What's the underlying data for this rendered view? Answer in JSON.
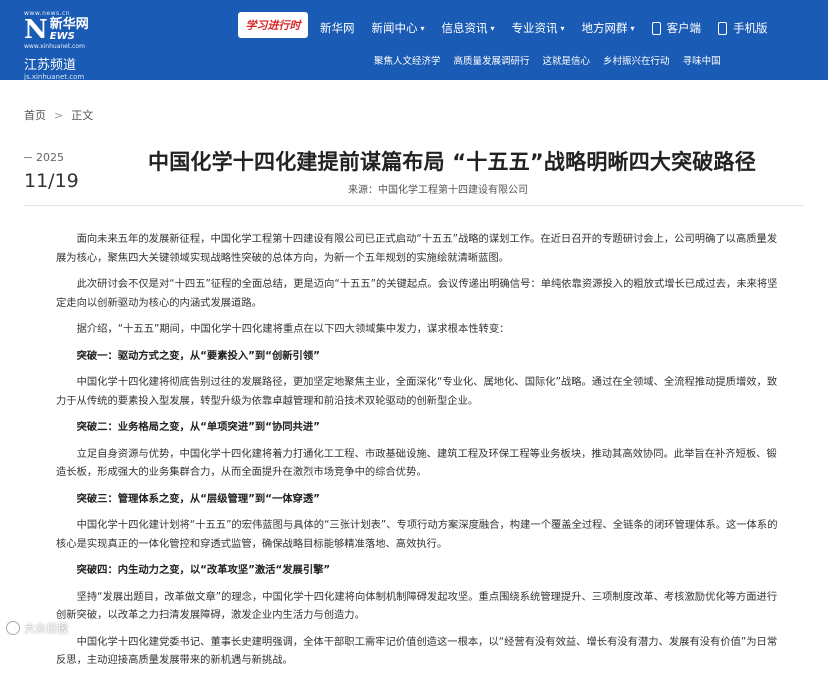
{
  "header": {
    "logo_url": "www.news.cn",
    "logo_n": "N",
    "logo_cn": "新华网",
    "logo_news": "EWS",
    "logo_url2": "www.xinhuanet.com",
    "channel": "江苏频道",
    "channel_url": "js.xinhuanet.com",
    "badge_text": "学习进行时",
    "nav": [
      {
        "label": "新华网",
        "chevron": false
      },
      {
        "label": "新闻中心",
        "chevron": true
      },
      {
        "label": "信息资讯",
        "chevron": true
      },
      {
        "label": "专业资讯",
        "chevron": true
      },
      {
        "label": "地方网群",
        "chevron": true
      },
      {
        "label": "客户端",
        "icon": "phone-icon"
      },
      {
        "label": "手机版",
        "icon": "mobile-icon"
      }
    ],
    "subnav": [
      "聚焦人文经济学",
      "高质量发展调研行",
      "这就是信心",
      "乡村振兴在行动",
      "寻味中国"
    ],
    "brand_color": "#1a5bb5"
  },
  "breadcrumb": {
    "home": "首页",
    "sep": ">",
    "current": "正文"
  },
  "article": {
    "year": "2025",
    "date": "11/19",
    "title": "中国化学十四化建提前谋篇布局 “十五五”战略明晰四大突破路径",
    "source": "来源：中国化学工程第十四建设有限公司",
    "paragraphs": [
      {
        "type": "p",
        "text": "面向未来五年的发展新征程，中国化学工程第十四建设有限公司已正式启动“十五五”战略的谋划工作。在近日召开的专题研讨会上，公司明确了以高质量发展为核心，聚焦四大关键领域实现战略性突破的总体方向，为新一个五年规划的实施绘就清晰蓝图。"
      },
      {
        "type": "p",
        "text": "此次研讨会不仅是对“十四五”征程的全面总结，更是迈向“十五五”的关键起点。会议传递出明确信号：单纯依靠资源投入的粗放式增长已成过去，未来将坚定走向以创新驱动为核心的内涵式发展道路。"
      },
      {
        "type": "p",
        "text": "据介绍，“十五五”期间，中国化学十四化建将重点在以下四大领域集中发力，谋求根本性转变："
      },
      {
        "type": "h",
        "text": "突破一：驱动方式之变，从“要素投入”到“创新引领”"
      },
      {
        "type": "p",
        "text": "中国化学十四化建将彻底告别过往的发展路径，更加坚定地聚焦主业，全面深化“专业化、属地化、国际化”战略。通过在全领域、全流程推动提质增效，致力于从传统的要素投入型发展，转型升级为依靠卓越管理和前沿技术双轮驱动的创新型企业。"
      },
      {
        "type": "h",
        "text": "突破二：业务格局之变，从“单项突进”到“协同共进”"
      },
      {
        "type": "p",
        "text": "立足自身资源与优势，中国化学十四化建将着力打通化工工程、市政基础设施、建筑工程及环保工程等业务板块，推动其高效协同。此举旨在补齐短板、锻造长板，形成强大的业务集群合力，从而全面提升在激烈市场竞争中的综合优势。"
      },
      {
        "type": "h",
        "text": "突破三：管理体系之变，从“层级管理”到“一体穿透”"
      },
      {
        "type": "p",
        "text": "中国化学十四化建计划将“十五五”的宏伟蓝图与具体的“三张计划表”、专项行动方案深度融合，构建一个覆盖全过程、全链条的闭环管理体系。这一体系的核心是实现真正的一体化管控和穿透式监管，确保战略目标能够精准落地、高效执行。"
      },
      {
        "type": "h",
        "text": "突破四：内生动力之变，以“改革攻坚”激活“发展引擎”"
      },
      {
        "type": "p",
        "text": "坚持“发展出题目，改革做文章”的理念，中国化学十四化建将向体制机制障碍发起攻坚。重点围绕系统管理提升、三项制度改革、考核激励优化等方面进行创新突破，以改革之力扫清发展障碍，激发企业内生活力与创造力。"
      },
      {
        "type": "p",
        "text": "中国化学十四化建党委书记、董事长史建明强调，全体干部职工需牢记价值创造这一根本，以“经营有没有效益、增长有没有潜力、发展有没有价值”为日常反思，主动迎接高质量发展带来的新机遇与新挑战。"
      }
    ]
  },
  "watermark": "大众日报"
}
